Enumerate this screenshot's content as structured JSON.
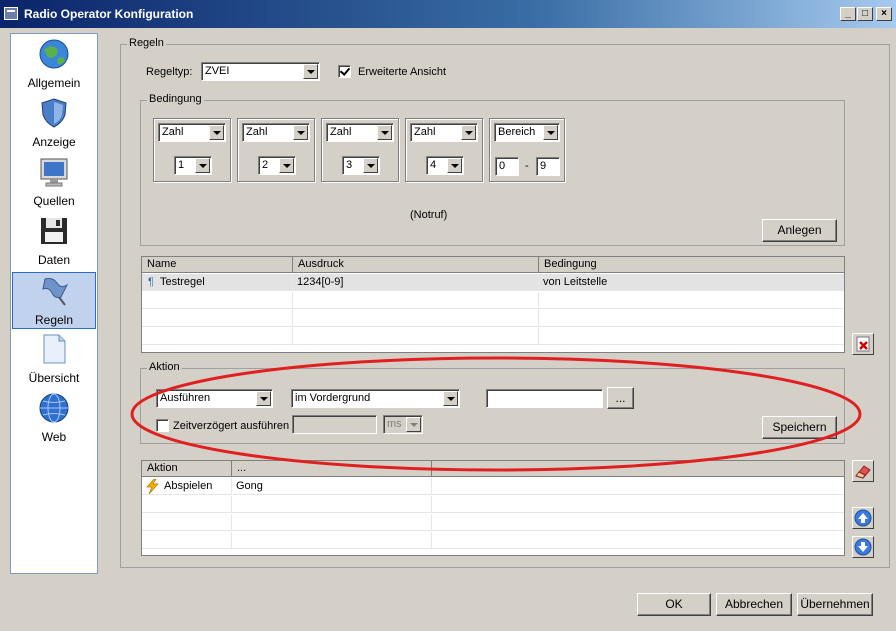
{
  "window": {
    "title": "Radio Operator Konfiguration",
    "controls": [
      "_",
      "□",
      "×"
    ]
  },
  "sidebar": {
    "items": [
      {
        "label": "Allgemein",
        "icon": "globe-icon"
      },
      {
        "label": "Anzeige",
        "icon": "shield-icon"
      },
      {
        "label": "Quellen",
        "icon": "monitor-icon"
      },
      {
        "label": "Daten",
        "icon": "floppy-disk-icon"
      },
      {
        "label": "Regeln",
        "icon": "flag-icon",
        "selected": true
      },
      {
        "label": "Übersicht",
        "icon": "document-icon"
      },
      {
        "label": "Web",
        "icon": "web-globe-icon"
      }
    ]
  },
  "regeln": {
    "caption": "Regeln",
    "regeltyp_label": "Regeltyp:",
    "regeltyp_value": "ZVEI",
    "erweitert_label": "Erweiterte Ansicht",
    "erweitert_checked": true
  },
  "bedingung": {
    "caption": "Bedingung",
    "groups": [
      {
        "type": "Zahl",
        "value": "1"
      },
      {
        "type": "Zahl",
        "value": "2"
      },
      {
        "type": "Zahl",
        "value": "3"
      },
      {
        "type": "Zahl",
        "value": "4"
      }
    ],
    "range": {
      "type": "Bereich",
      "from": "0",
      "separator": "-",
      "to": "9"
    },
    "note": "(Notruf)",
    "anlegen_label": "Anlegen"
  },
  "rules_table": {
    "columns": [
      "Name",
      "Ausdruck",
      "Bedingung"
    ],
    "rows": [
      {
        "name": "Testregel",
        "ausdruck": "1234[0-9]",
        "bedingung": "von Leitstelle"
      }
    ]
  },
  "aktion": {
    "caption": "Aktion",
    "action_value": "Ausführen",
    "mode_value": "im Vordergrund",
    "param_value": "",
    "browse_label": "...",
    "delay_label": "Zeitverzögert ausführen",
    "delay_checked": false,
    "delay_value": "",
    "delay_unit": "ms",
    "speichern_label": "Speichern"
  },
  "actions_table": {
    "columns": [
      "Aktion",
      "...",
      ""
    ],
    "rows": [
      {
        "aktion": "Abspielen",
        "param": "Gong"
      }
    ]
  },
  "footer": {
    "ok_label": "OK",
    "cancel_label": "Abbrechen",
    "apply_label": "Übernehmen"
  },
  "colors": {
    "titlebar_start": "#0a246a",
    "titlebar_end": "#a6caf0",
    "window_bg": "#d4d0c8",
    "selection": "#c1d2ee",
    "annotation_ellipse": "#e02020"
  }
}
